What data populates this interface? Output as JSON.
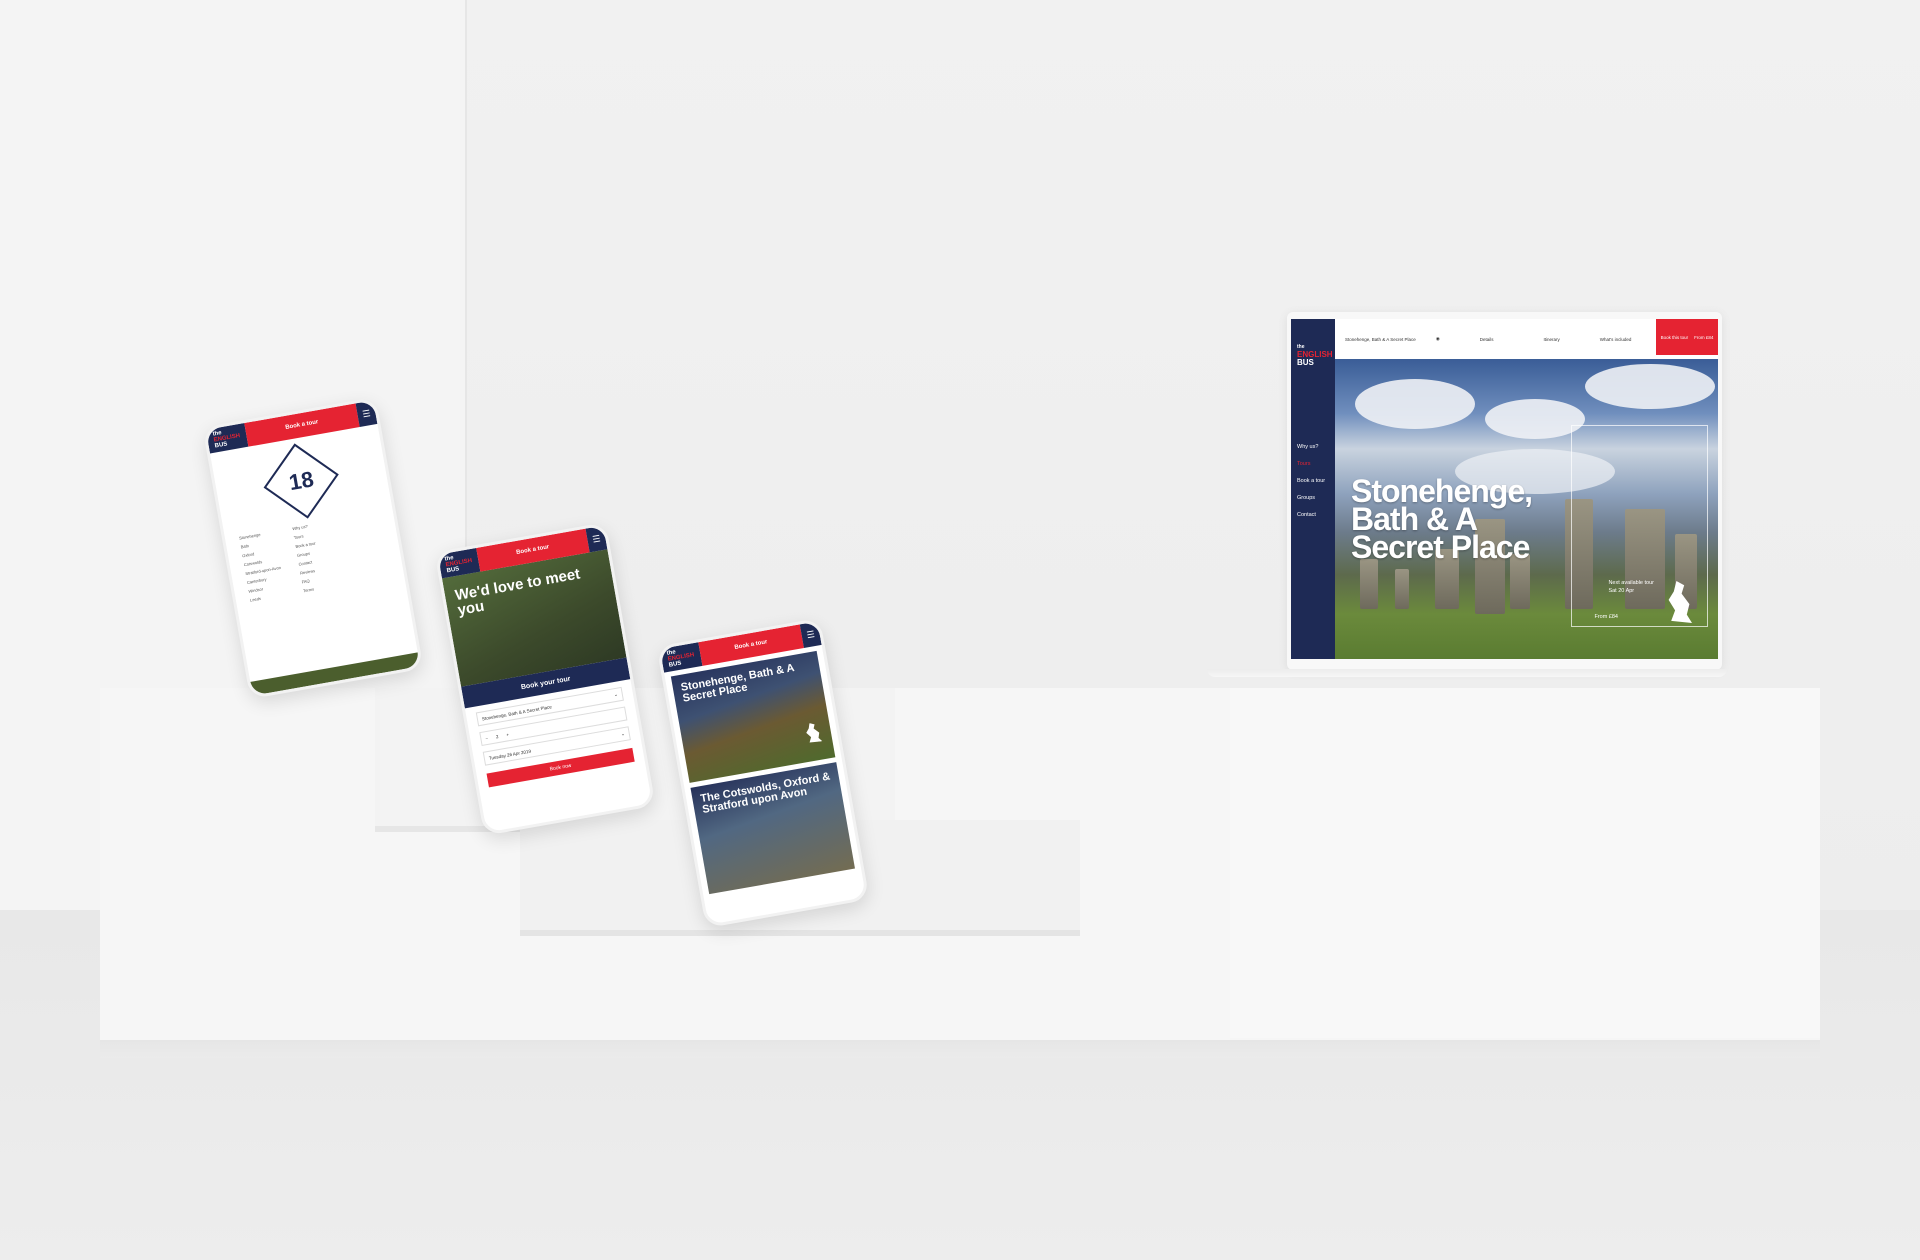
{
  "scene": {
    "description_visible": false
  },
  "brand": {
    "the": "the",
    "english": "ENGLISH",
    "bus": "BUS",
    "red": "#e52332",
    "navy": "#1e2a55"
  },
  "phone1": {
    "book_label": "Book a tour",
    "badge_number": "18",
    "col1": [
      "Stonehenge",
      "Bath",
      "Oxford",
      "Cotswolds",
      "Stratford-upon-Avon",
      "Canterbury",
      "Windsor",
      "Leeds"
    ],
    "col2": [
      "Why us?",
      "Tours",
      "Book a tour",
      "Groups",
      "Contact",
      "Reviews",
      "FAQ",
      "Terms"
    ]
  },
  "phone2": {
    "book_label": "Book a tour",
    "hero_title": "We'd love to meet you",
    "cta_bar": "Book your tour",
    "tour_value": "Stonehenge, Bath & A Secret Place",
    "date_value": "Tuesday 26 Apr 2019",
    "qty_value": "2",
    "button": "Book now"
  },
  "phone3": {
    "book_label": "Book a tour",
    "card1_title": "Stonehenge, Bath & A Secret Place",
    "card2_title": "The Cotswolds, Oxford & Stratford upon Avon"
  },
  "laptop": {
    "tour_select": "Stonehenge, Bath & A Secret Place",
    "tabs": [
      "Details",
      "Itinerary",
      "What's included"
    ],
    "book_label": "Book this tour",
    "price_label": "From £84",
    "nav": [
      "Why us?",
      "Tours",
      "Book a tour",
      "Groups",
      "Contact"
    ],
    "hero_title": "Stonehenge, Bath & A Secret Place",
    "next_label": "Next available tour",
    "next_date": "Sat 20 Apr",
    "from_price": "From £84"
  },
  "icons": [
    "menu-icon",
    "chevron-down-icon",
    "uk-map-icon"
  ]
}
